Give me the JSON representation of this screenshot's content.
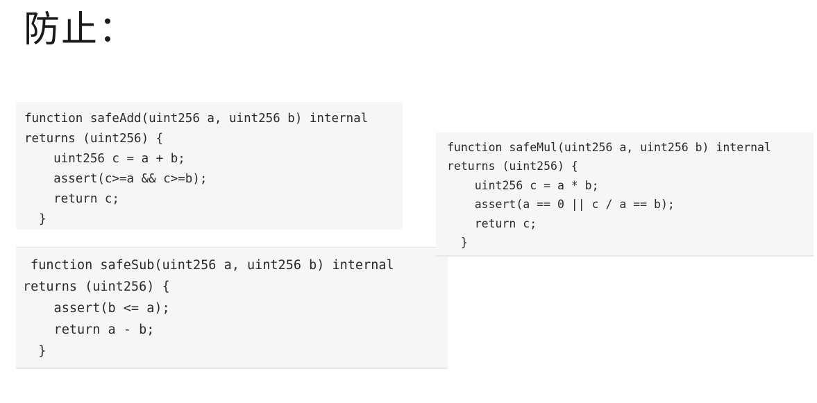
{
  "title": "防止：",
  "code_blocks": {
    "safe_add": {
      "lines": [
        "function safeAdd(uint256 a, uint256 b) internal",
        "returns (uint256) {",
        "    uint256 c = a + b;",
        "    assert(c>=a && c>=b);",
        "    return c;",
        "  }"
      ]
    },
    "safe_sub": {
      "lines": [
        " function safeSub(uint256 a, uint256 b) internal",
        "returns (uint256) {",
        "    assert(b <= a);",
        "    return a - b;",
        "  }"
      ]
    },
    "safe_mul": {
      "lines": [
        "function safeMul(uint256 a, uint256 b) internal",
        "returns (uint256) {",
        "    uint256 c = a * b;",
        "    assert(a == 0 || c / a == b);",
        "    return c;",
        "  }"
      ]
    }
  }
}
